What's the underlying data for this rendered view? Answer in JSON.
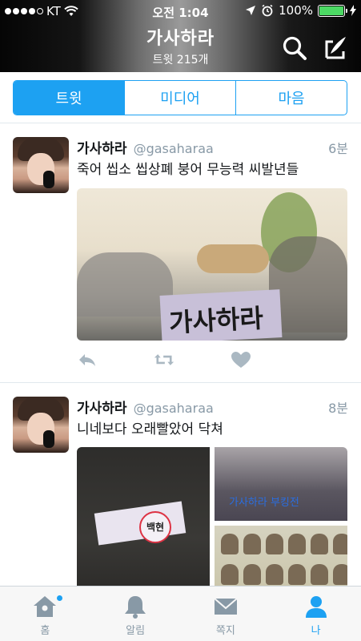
{
  "status_bar": {
    "carrier": "KT",
    "time": "오전 1:04",
    "battery": "100%",
    "battery_color": "#4cd964"
  },
  "header": {
    "title": "가사하라",
    "subtitle": "트윗 215개",
    "search_icon": "search-icon",
    "compose_icon": "compose-icon"
  },
  "tabs": [
    {
      "label": "트윗",
      "active": true
    },
    {
      "label": "미디어",
      "active": false
    },
    {
      "label": "마음",
      "active": false
    }
  ],
  "tweets": [
    {
      "name": "가사하라",
      "handle": "@gasaharaa",
      "time": "6분",
      "text": "죽어 씹소 씹상폐 붕어 무능력 씨발년들",
      "media_text": "가사하라"
    },
    {
      "name": "가사하라",
      "handle": "@gasaharaa",
      "time": "8분",
      "text": "니네보다 오래빨았어 닥쳐",
      "media_badge": "백현",
      "media_scribble": "가사하라 부킹전"
    }
  ],
  "tweet_actions": [
    "reply-icon",
    "retweet-icon",
    "like-icon"
  ],
  "tabbar": [
    {
      "label": "홈",
      "icon": "home-icon",
      "active": false,
      "has_dot": true
    },
    {
      "label": "알림",
      "icon": "bell-icon",
      "active": false
    },
    {
      "label": "쪽지",
      "icon": "envelope-icon",
      "active": false
    },
    {
      "label": "나",
      "icon": "person-icon",
      "active": true
    }
  ],
  "colors": {
    "accent": "#1da1f2",
    "muted": "#8899a6"
  }
}
